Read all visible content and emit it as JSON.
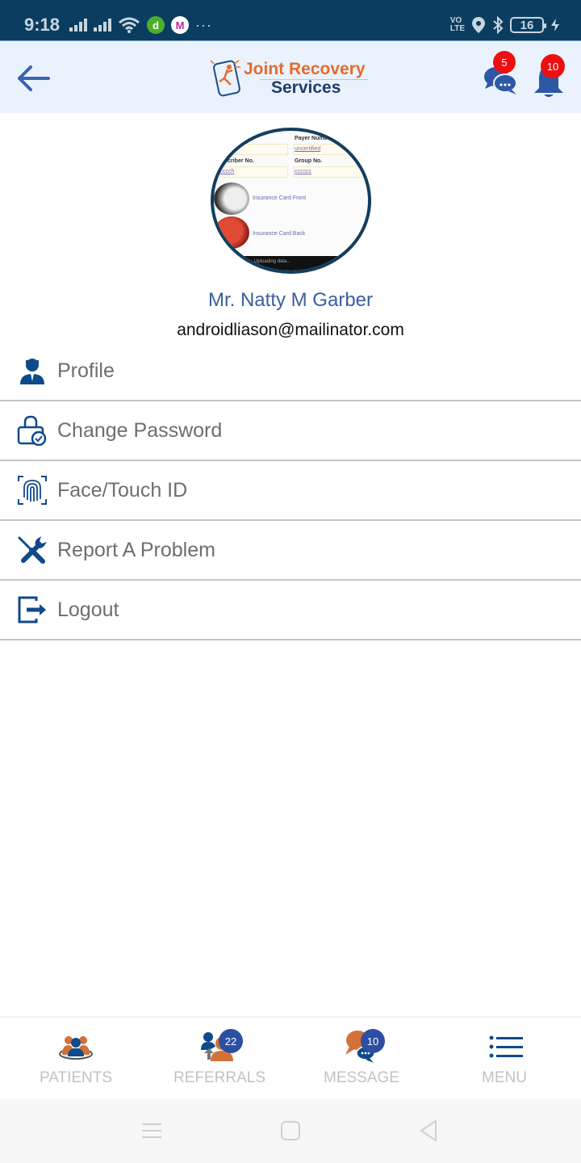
{
  "status_bar": {
    "time": "9:18",
    "battery_level": "16",
    "volte_label": "VO LTE2",
    "left_icons": [
      "signal-icon",
      "signal-icon",
      "wifi-icon",
      "app-d-icon",
      "app-m-icon",
      "more-dots-icon"
    ],
    "right_icons": [
      "volte-icon",
      "location-icon",
      "bluetooth-icon",
      "battery-icon",
      "charging-icon"
    ],
    "overflow": "···"
  },
  "header": {
    "back_icon": "arrow-left-icon",
    "logo_line1": "Joint Recovery",
    "logo_line2": "Services",
    "chat_badge": "5",
    "notification_badge": "10"
  },
  "avatar": {
    "labels": {
      "payer": "Payer Numb",
      "subscriber": "Subscriber No.",
      "group": "Group No.",
      "payer_val": "uncertified",
      "subscriber_val": "ccccch",
      "group_val": "cccccc",
      "card_front": "Insurance Card Front",
      "card_back": "Insurance Card Back",
      "footer": "Uploading data..."
    }
  },
  "user": {
    "name": "Mr. Natty M Garber",
    "email": "androidliason@mailinator.com"
  },
  "menu": {
    "items": [
      {
        "label": "Profile",
        "icon": "profile-icon"
      },
      {
        "label": "Change Password",
        "icon": "lock-check-icon"
      },
      {
        "label": "Face/Touch ID",
        "icon": "fingerprint-icon"
      },
      {
        "label": "Report A Problem",
        "icon": "tools-icon"
      },
      {
        "label": "Logout",
        "icon": "logout-icon"
      }
    ]
  },
  "bottom_nav": {
    "tabs": [
      {
        "label": "PATIENTS",
        "icon": "patients-icon",
        "badge": null
      },
      {
        "label": "REFERRALS",
        "icon": "referrals-icon",
        "badge": "22"
      },
      {
        "label": "MESSAGE",
        "icon": "message-icon",
        "badge": "10"
      },
      {
        "label": "MENU",
        "icon": "menu-list-icon",
        "badge": null
      }
    ]
  },
  "colors": {
    "status_bar": "#0b3d60",
    "header_bg": "#eaf3fd",
    "brand_orange": "#e46b2c",
    "brand_navy": "#1f3c6e",
    "icon_blue": "#0f4a8a",
    "badge_red": "#ee1010",
    "badge_blue": "#2d4fa3",
    "name_blue": "#3a5fa0",
    "menu_text": "#6e6e6e"
  }
}
